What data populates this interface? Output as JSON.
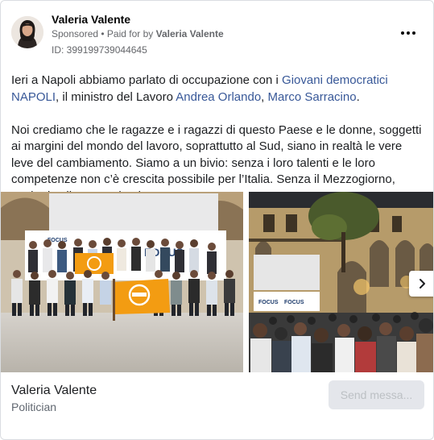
{
  "header": {
    "name": "Valeria Valente",
    "sponsored": "Sponsored",
    "paid_for_prefix": " • Paid for by ",
    "paid_for_by": "Valeria Valente",
    "id_text": "ID: 399199739044645"
  },
  "post": {
    "p1_a": "Ieri a Napoli abbiamo parlato di occupazione con i ",
    "p1_link1": "Giovani democratici NAPOLI",
    "p1_b": ", il ministro del Lavoro ",
    "p1_link2": "Andrea Orlando",
    "p1_c": ", ",
    "p1_link3": "Marco Sarracino",
    "p1_d": ".",
    "p2": "Noi crediamo che le ragazze e i ragazzi di questo Paese e le donne, soggetti ai margini del mondo del lavoro, soprattutto al Sud, siano in realtà le vere leve del cambiamento. Siamo a un bivio: senza i loro talenti e le loro competenze non c’è crescita possibile per l’Italia. Senza il Mezzogiorno, anche l’Italia resta al palo...."
  },
  "photos": {
    "photo1_banner": "FOCUS",
    "photo2_banner_left": "FOCUS",
    "photo2_banner_right": "FOCUS"
  },
  "footer": {
    "name": "Valeria Valente",
    "category": "Politician",
    "send_button": "Send messa..."
  },
  "icons": {
    "more": "more-horizontal-icon",
    "next": "chevron-right-icon"
  },
  "colors": {
    "link": "#385898",
    "secondary_text": "#65676b",
    "button_bg": "#e4e6eb",
    "flag_orange": "#f39c12"
  }
}
